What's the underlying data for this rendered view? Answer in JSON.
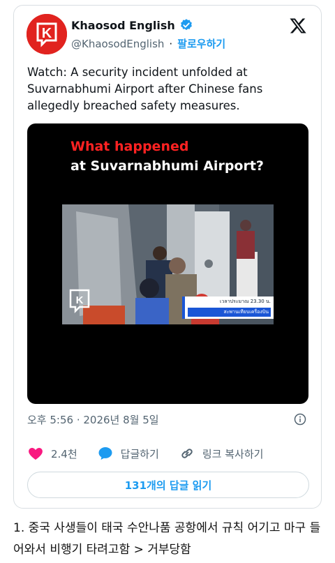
{
  "tweet": {
    "display_name": "Khaosod English",
    "handle": "@KhaosodEnglish",
    "follow_label": "팔로우하기",
    "avatar_letter": "K",
    "text": "Watch: A security incident unfolded at Suvarnabhumi Airport after Chinese fans allegedly breached safety measures.",
    "timestamp": "오후 5:56 · 2026년 8월 5일",
    "colors": {
      "accent": "#1d9bf0",
      "brand": "#e1231f",
      "like": "#f91880"
    }
  },
  "media": {
    "title_line1": "What happened",
    "title_line2": "at Suvarnabhumi Airport?",
    "caption_line1": "เวลาประมาณ 23.30 น.",
    "caption_line2": "สะพานเทียบเครื่องบิน",
    "logo_letter": "K"
  },
  "actions": {
    "like_count": "2.4천",
    "reply_label": "답글하기",
    "copy_link_label": "링크 복사하기"
  },
  "replies_button": "131개의 답글 읽기",
  "post_body": "1. 중국 사생들이 태국 수안나품 공항에서 규칙 어기고 마구 들어와서 비행기 타려고함 > 거부당함",
  "icons": [
    "verified-icon",
    "x-logo-icon",
    "info-icon",
    "heart-icon",
    "reply-bubble-icon",
    "link-icon"
  ]
}
